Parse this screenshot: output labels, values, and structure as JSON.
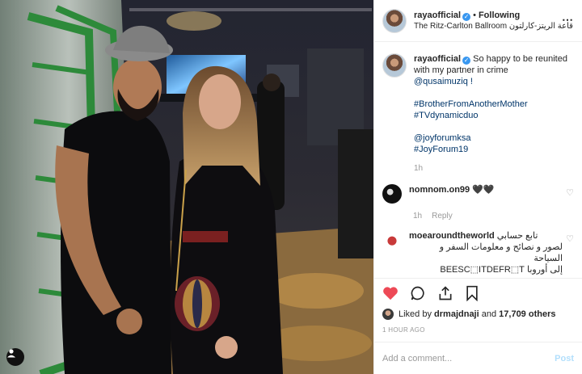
{
  "header": {
    "username": "rayaofficial",
    "follow_label": "Following",
    "location": "The Ritz-Carlton Ballroom قاعة الريتز-كارلتون",
    "separator": "•"
  },
  "caption": {
    "username": "rayaofficial",
    "text": "So happy to be reunited with my partner in crime",
    "mention": "@qusaimuziq !",
    "tags": [
      "#BrotherFromAnotherMother",
      "#TVdynamicduo"
    ],
    "mentions2": [
      "@joyforumksa",
      "#JoyForum19"
    ],
    "time": "1h"
  },
  "comments": [
    {
      "username": "nomnom.on99",
      "text": "🖤🖤",
      "time": "1h",
      "reply_label": "Reply"
    },
    {
      "username": "moearoundtheworld",
      "text_line1": "تابع حسابي",
      "text_line2": "لصور و نصائح و معلومات السفر و السياحة",
      "text_line3": "إلى أوروبا BEESC⬚ITDEFR⬚T"
    }
  ],
  "likes": {
    "prefix": "Liked by",
    "user": "drmajdnaji",
    "and": "and",
    "count": "17,709 others"
  },
  "timestamp": "1 HOUR AGO",
  "add_comment": {
    "placeholder": "Add a comment...",
    "post_label": "Post"
  },
  "colors": {
    "like_red": "#ed4956",
    "link_blue": "#003569",
    "verified_blue": "#3897f0"
  },
  "icons": [
    "heart-icon",
    "comment-icon",
    "share-icon",
    "bookmark-icon",
    "more-icon",
    "user-tag-icon",
    "verified-icon"
  ]
}
